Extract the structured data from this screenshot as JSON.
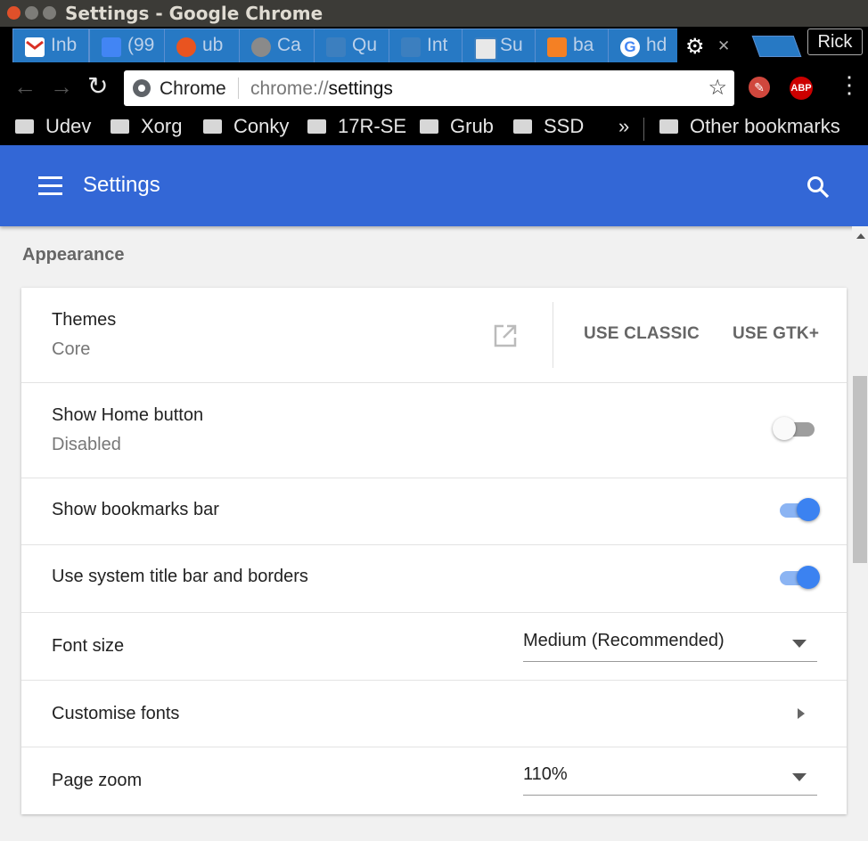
{
  "window": {
    "title": "Settings - Google Chrome"
  },
  "tabs": [
    {
      "label": "Inb",
      "icon": "gmail-icon",
      "color": "#d93025"
    },
    {
      "label": "(99",
      "icon": "messages-icon",
      "color": "#4285f4"
    },
    {
      "label": "ub",
      "icon": "askubuntu-icon",
      "color": "#e95420"
    },
    {
      "label": "Ca",
      "icon": "askubuntu-icon",
      "color": "#8a8a8a"
    },
    {
      "label": "Qu",
      "icon": "stackexchange-icon",
      "color": "#3c7fbf"
    },
    {
      "label": "Int",
      "icon": "stackexchange-icon",
      "color": "#3c7fbf"
    },
    {
      "label": "Su",
      "icon": "superuser-icon",
      "color": "#e8e8e8"
    },
    {
      "label": "ba",
      "icon": "stackoverflow-icon",
      "color": "#f48024"
    },
    {
      "label": "hd",
      "icon": "google-icon",
      "color": "#ffffff"
    }
  ],
  "active_tab": {
    "icon": "gear-icon",
    "close": "✕"
  },
  "profile": {
    "name": "Rick"
  },
  "omnibox": {
    "chip": "Chrome",
    "url_prefix": "chrome://",
    "url_path": "settings"
  },
  "bookmarks": {
    "items": [
      "Udev",
      "Xorg",
      "Conky",
      "17R-SE",
      "Grub",
      "SSD"
    ],
    "overflow": "»",
    "other": "Other bookmarks"
  },
  "appbar": {
    "title": "Settings"
  },
  "section": {
    "title": "Appearance"
  },
  "settings": {
    "themes": {
      "label": "Themes",
      "value": "Core",
      "btn_classic": "USE CLASSIC",
      "btn_gtk": "USE GTK+"
    },
    "home_button": {
      "label": "Show Home button",
      "value": "Disabled",
      "enabled": false
    },
    "bookmarks_bar": {
      "label": "Show bookmarks bar",
      "enabled": true
    },
    "system_title_bar": {
      "label": "Use system title bar and borders",
      "enabled": true
    },
    "font_size": {
      "label": "Font size",
      "value": "Medium (Recommended)"
    },
    "customise_fonts": {
      "label": "Customise fonts"
    },
    "page_zoom": {
      "label": "Page zoom",
      "value": "110%"
    }
  },
  "colors": {
    "appbar": "#3367d6",
    "toggle_on": "#3b82f1",
    "tab": "#2779c4"
  }
}
